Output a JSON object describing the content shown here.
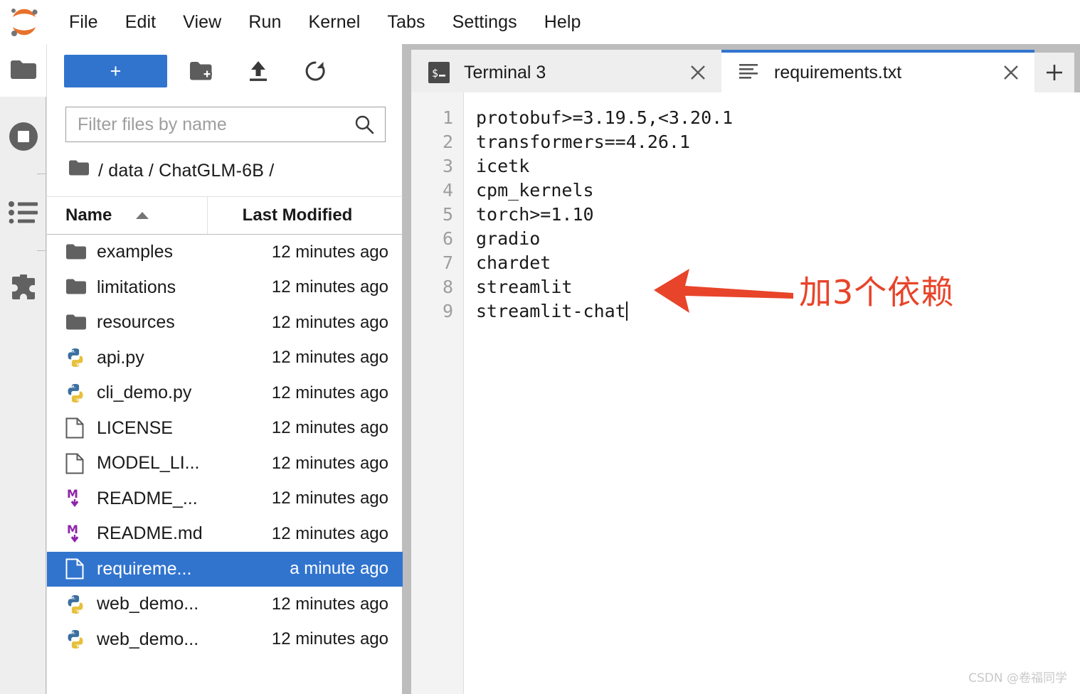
{
  "app": {
    "logo": "jupyter-logo",
    "menu": [
      "File",
      "Edit",
      "View",
      "Run",
      "Kernel",
      "Tabs",
      "Settings",
      "Help"
    ]
  },
  "activity_bar": {
    "items": [
      {
        "icon": "folder-icon",
        "name": "file-browser"
      },
      {
        "icon": "running-terminals-icon",
        "name": "running"
      },
      {
        "icon": "command-palette-icon",
        "name": "commands"
      },
      {
        "icon": "extension-puzzle-icon",
        "name": "extensions"
      }
    ]
  },
  "file_browser": {
    "toolbar": {
      "new_launcher_label": "+",
      "new_folder_icon": "new-folder-icon",
      "upload_icon": "upload-icon",
      "refresh_icon": "refresh-icon"
    },
    "filter": {
      "placeholder": "Filter files by name",
      "value": "",
      "icon": "search-icon"
    },
    "breadcrumb": {
      "icon": "folder-icon",
      "path": "/ data / ChatGLM-6B /"
    },
    "columns": {
      "name": "Name",
      "last_modified": "Last Modified",
      "sort_icon": "caret-up-icon"
    },
    "files": [
      {
        "icon": "folder-icon",
        "name": "examples",
        "modified": "12 minutes ago",
        "selected": false
      },
      {
        "icon": "folder-icon",
        "name": "limitations",
        "modified": "12 minutes ago",
        "selected": false
      },
      {
        "icon": "folder-icon",
        "name": "resources",
        "modified": "12 minutes ago",
        "selected": false
      },
      {
        "icon": "python-icon",
        "name": "api.py",
        "modified": "12 minutes ago",
        "selected": false
      },
      {
        "icon": "python-icon",
        "name": "cli_demo.py",
        "modified": "12 minutes ago",
        "selected": false
      },
      {
        "icon": "text-file-icon",
        "name": "LICENSE",
        "modified": "12 minutes ago",
        "selected": false
      },
      {
        "icon": "text-file-icon",
        "name": "MODEL_LI...",
        "modified": "12 minutes ago",
        "selected": false
      },
      {
        "icon": "markdown-icon",
        "name": "README_...",
        "modified": "12 minutes ago",
        "selected": false
      },
      {
        "icon": "markdown-icon",
        "name": "README.md",
        "modified": "12 minutes ago",
        "selected": false
      },
      {
        "icon": "text-file-icon",
        "name": "requireme...",
        "modified": "a minute ago",
        "selected": true
      },
      {
        "icon": "python-icon",
        "name": "web_demo...",
        "modified": "12 minutes ago",
        "selected": false
      },
      {
        "icon": "python-icon",
        "name": "web_demo...",
        "modified": "12 minutes ago",
        "selected": false
      }
    ]
  },
  "dock": {
    "tabs": [
      {
        "label": "Terminal 3",
        "icon": "terminal-icon",
        "active": false,
        "close_icon": "close-icon"
      },
      {
        "label": "requirements.txt",
        "icon": "text-editor-icon",
        "active": true,
        "close_icon": "close-icon"
      }
    ],
    "add_tab_label": "+"
  },
  "editor": {
    "line_numbers": [
      "1",
      "2",
      "3",
      "4",
      "5",
      "6",
      "7",
      "8",
      "9"
    ],
    "lines": [
      "protobuf>=3.19.5,<3.20.1",
      "transformers==4.26.1",
      "icetk",
      "cpm_kernels",
      "torch>=1.10",
      "gradio",
      "chardet",
      "streamlit",
      "streamlit-chat"
    ]
  },
  "annotation": {
    "text": "加3个依赖",
    "arrow_icon": "left-arrow-annotation",
    "color": "#e8442a"
  },
  "watermark": {
    "text": "CSDN @卷福同学"
  },
  "colors": {
    "accent_blue": "#3174ce",
    "tabbar_gray": "#bdbdbd",
    "panel_gray": "#eeeeee",
    "annotation_red": "#e8442a"
  }
}
